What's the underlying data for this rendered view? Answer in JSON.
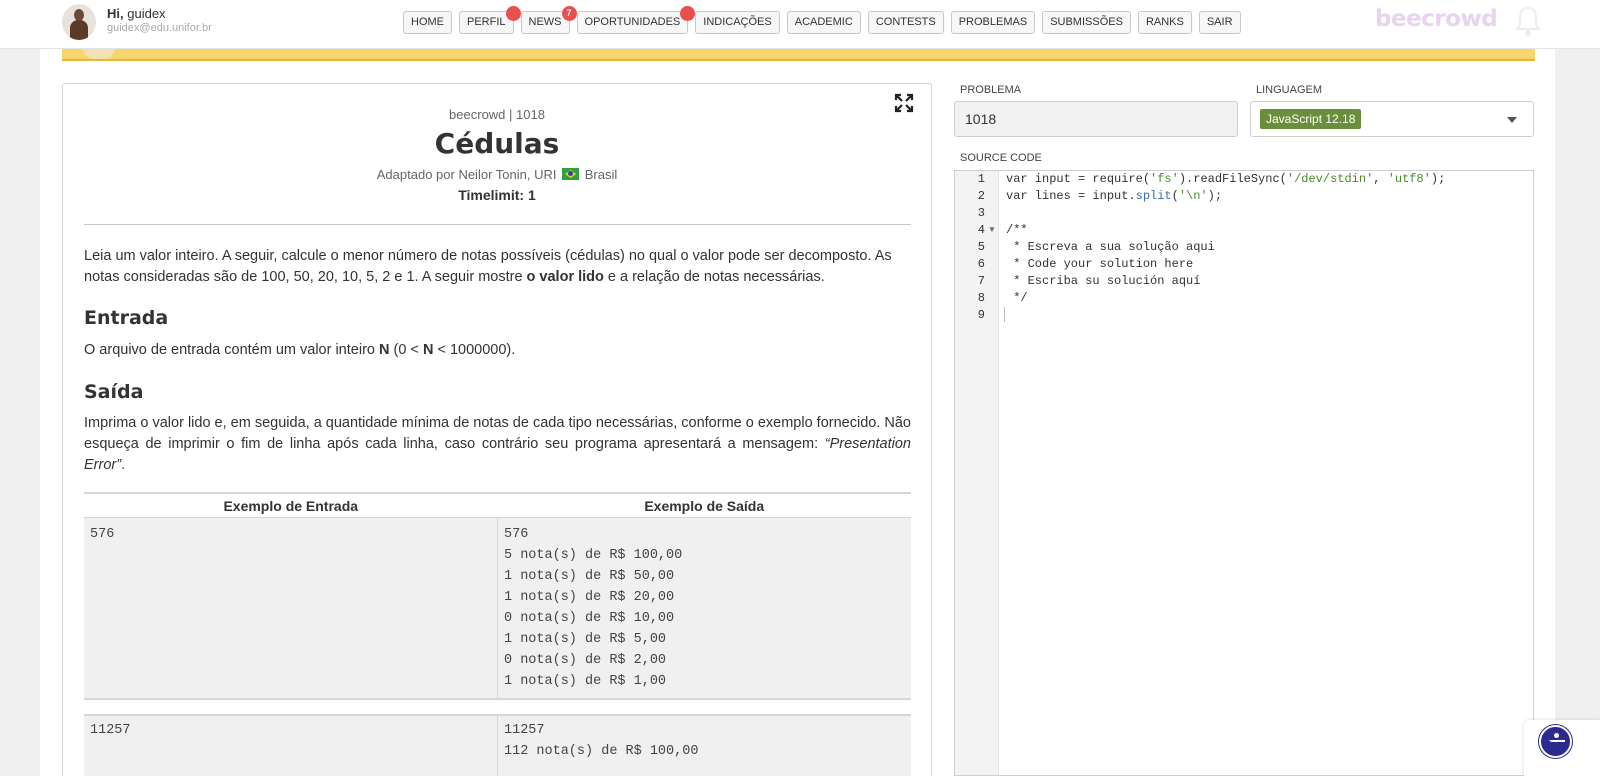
{
  "user": {
    "greeting": "Hi,",
    "name": "guidex",
    "email": "guidex@edu.unifor.br"
  },
  "nav": [
    {
      "label": "HOME"
    },
    {
      "label": "PERFIL",
      "badge": ""
    },
    {
      "label": "NEWS",
      "badge": "7"
    },
    {
      "label": "OPORTUNIDADES",
      "badge": ""
    },
    {
      "label": "INDICAÇÕES"
    },
    {
      "label": "ACADEMIC"
    },
    {
      "label": "CONTESTS"
    },
    {
      "label": "PROBLEMAS"
    },
    {
      "label": "SUBMISSÕES"
    },
    {
      "label": "RANKS"
    },
    {
      "label": "SAIR"
    }
  ],
  "brand": "beecrowd",
  "problem": {
    "crumb": "beecrowd | 1018",
    "title": "Cédulas",
    "author_prefix": "Adaptado por Neilor Tonin, URI",
    "author_country": "Brasil",
    "timelimit": "Timelimit: 1",
    "intro_1": "Leia um valor inteiro. A seguir, calcule o menor número de notas possíveis (cédulas) no qual o valor pode ser decomposto. As notas consideradas são de 100, 50, 20, 10, 5, 2 e 1. A seguir mostre",
    "intro_bold": "o valor lido",
    "intro_2": "e a relação de notas necessárias.",
    "input_heading": "Entrada",
    "input_1": "O arquivo de entrada contém um valor inteiro",
    "input_n": "N",
    "input_2": "(0 <",
    "input_3": "< 1000000).",
    "output_heading": "Saída",
    "output_text": "Imprima o valor lido e, em seguida, a quantidade mínima de notas de cada tipo necessárias, conforme o exemplo fornecido. Não esqueça de imprimir o fim de linha após cada linha, caso contrário seu programa apresentará a mensagem:",
    "output_em": "“Presentation Error”",
    "output_end": ".",
    "example_input_header": "Exemplo de Entrada",
    "example_output_header": "Exemplo de Saída",
    "example1_input": "576",
    "example1_output": "576\n5 nota(s) de R$ 100,00\n1 nota(s) de R$ 50,00\n1 nota(s) de R$ 20,00\n0 nota(s) de R$ 10,00\n1 nota(s) de R$ 5,00\n0 nota(s) de R$ 2,00\n1 nota(s) de R$ 1,00",
    "example2_input": "11257",
    "example2_output": "11257\n112 nota(s) de R$ 100,00"
  },
  "form": {
    "problem_label": "PROBLEMA",
    "problem_value": "1018",
    "language_label": "LINGUAGEM",
    "language_value": "JavaScript 12.18",
    "source_label": "SOURCE CODE"
  },
  "code_lines": [
    "var input = require('fs').readFileSync('/dev/stdin', 'utf8');",
    "var lines = input.split('\\n');",
    "",
    "/**",
    " * Escreva a sua solução aqui",
    " * Code your solution here",
    " * Escriba su solución aquí",
    " */",
    ""
  ],
  "line_numbers": [
    "1",
    "2",
    "3",
    "4",
    "5",
    "6",
    "7",
    "8",
    "9"
  ]
}
